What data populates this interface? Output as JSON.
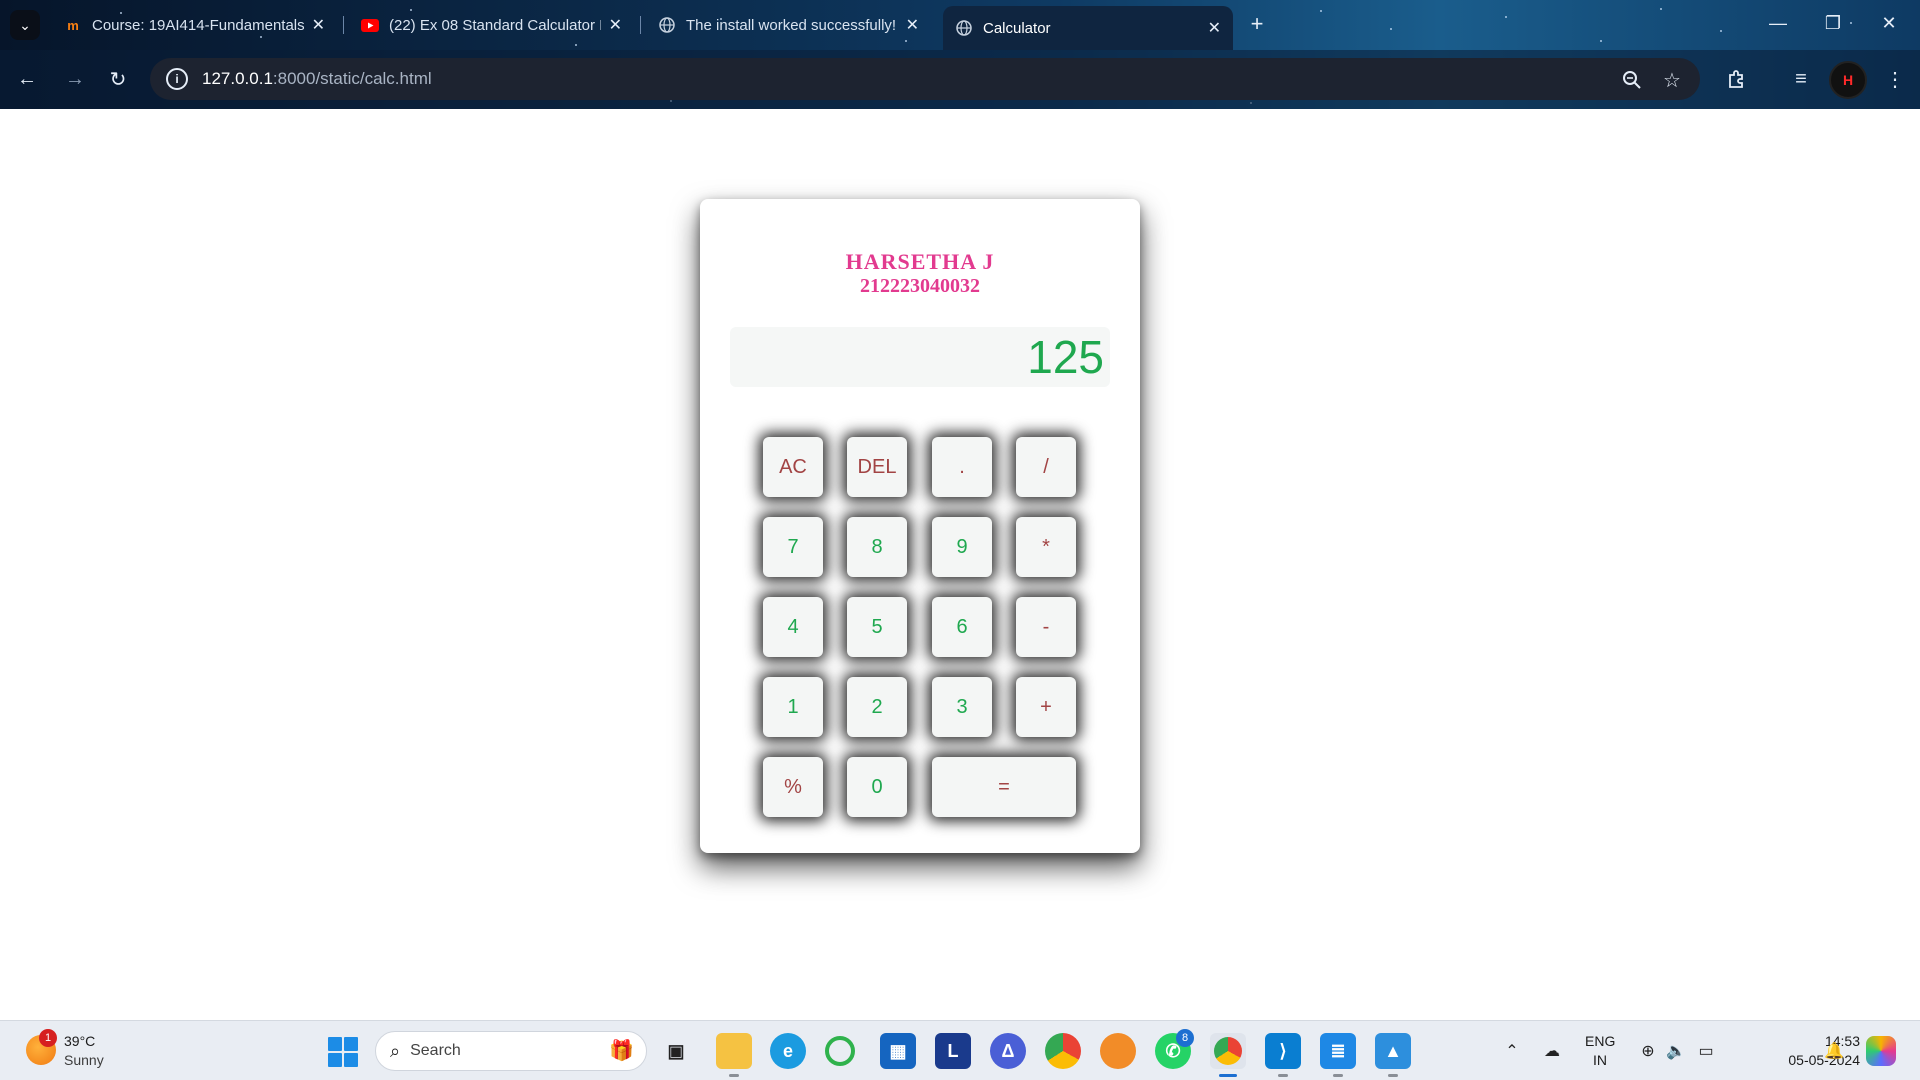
{
  "browser": {
    "tabs": [
      {
        "title": "Course: 19AI414-Fundamentals",
        "favicon": "moodle-icon"
      },
      {
        "title": "(22) Ex 08 Standard Calculator I",
        "favicon": "youtube-icon"
      },
      {
        "title": "The install worked successfully!",
        "favicon": "globe-icon"
      },
      {
        "title": "Calculator",
        "favicon": "globe-icon",
        "active": true
      }
    ],
    "url_host": "127.0.0.1",
    "url_path": ":8000/static/calc.html",
    "profile_initials": "H"
  },
  "calculator": {
    "name": "HARSETHA J",
    "id": "212223040032",
    "display": "125",
    "keys": {
      "ac": "AC",
      "del": "DEL",
      "dot": ".",
      "div": "/",
      "k7": "7",
      "k8": "8",
      "k9": "9",
      "mul": "*",
      "k4": "4",
      "k5": "5",
      "k6": "6",
      "sub": "-",
      "k1": "1",
      "k2": "2",
      "k3": "3",
      "add": "+",
      "pct": "%",
      "k0": "0",
      "eq": "="
    },
    "colors": {
      "number_keys": "#1fa84f",
      "operator_keys": "#a24444",
      "title": "#e23a8f"
    }
  },
  "taskbar": {
    "weather_temp": "39°C",
    "weather_cond": "Sunny",
    "weather_badge": "1",
    "search_label": "Search",
    "whatsapp_badge": "8",
    "lang_line1": "ENG",
    "lang_line2": "IN",
    "time": "14:53",
    "date": "05-05-2024"
  }
}
